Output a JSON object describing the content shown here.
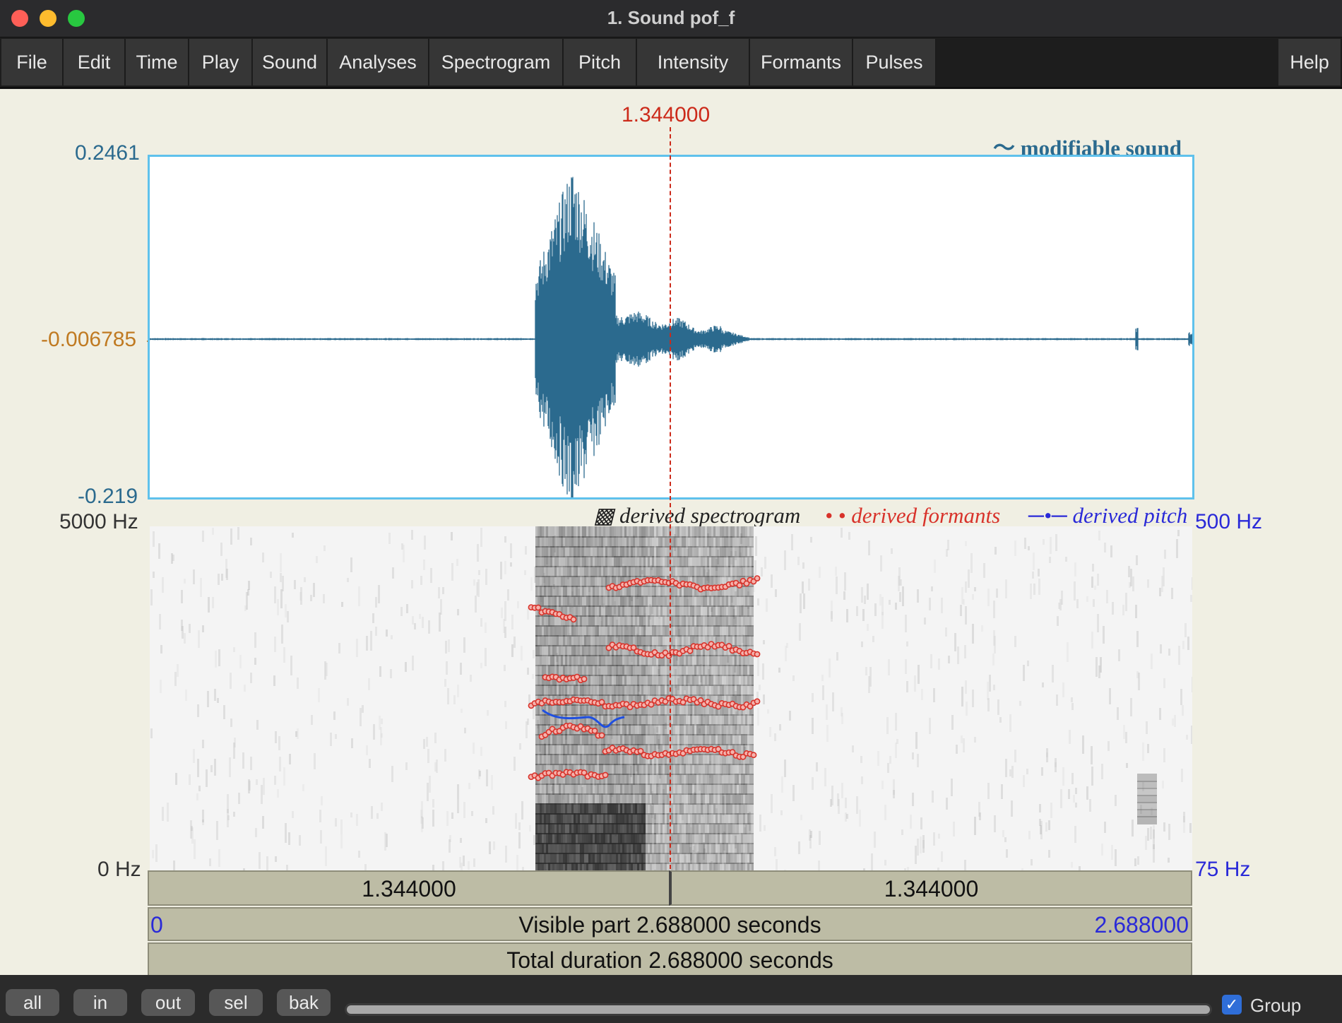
{
  "window": {
    "title": "1. Sound pof_f"
  },
  "menu": {
    "items": [
      {
        "label": "File",
        "name": "menu-file"
      },
      {
        "label": "Edit",
        "name": "menu-edit"
      },
      {
        "label": "Time",
        "name": "menu-time"
      },
      {
        "label": "Play",
        "name": "menu-play"
      },
      {
        "label": "Sound",
        "name": "menu-sound"
      },
      {
        "label": "Analyses",
        "name": "menu-analyses"
      },
      {
        "label": "Spectrogram",
        "name": "menu-spectrogram"
      },
      {
        "label": "Pitch",
        "name": "menu-pitch"
      },
      {
        "label": "Intensity",
        "name": "menu-intensity"
      },
      {
        "label": "Formants",
        "name": "menu-formants"
      },
      {
        "label": "Pulses",
        "name": "menu-pulses"
      }
    ],
    "help": "Help"
  },
  "cursor": {
    "time": "1.344000"
  },
  "waveform": {
    "title_icon": "〜",
    "title": "modifiable sound",
    "y_max": "0.2461",
    "y_mid": "-0.006785",
    "y_min": "-0.219"
  },
  "spectrogram": {
    "freq_max": "5000 Hz",
    "freq_min": "0 Hz",
    "pitch_max": "500 Hz",
    "pitch_min": "75 Hz",
    "legend": {
      "spectrogram_icon": "▩",
      "spectrogram": "derived spectrogram",
      "formants_icon": "• •",
      "formants": "derived formants",
      "pitch_icon": "─•─",
      "pitch": "derived pitch"
    }
  },
  "time_bars": {
    "left_segment": "1.344000",
    "right_segment": "1.344000",
    "visible_start": "0",
    "visible_label": "Visible part 2.688000 seconds",
    "visible_end": "2.688000",
    "total_label": "Total duration 2.688000 seconds"
  },
  "bottom": {
    "buttons": [
      {
        "label": "all",
        "name": "zoom-all-button"
      },
      {
        "label": "in",
        "name": "zoom-in-button"
      },
      {
        "label": "out",
        "name": "zoom-out-button"
      },
      {
        "label": "sel",
        "name": "zoom-sel-button"
      },
      {
        "label": "bak",
        "name": "zoom-back-button"
      }
    ],
    "group_checked": true,
    "group_label": "Group"
  },
  "colors": {
    "waveform": "#2b6a8e",
    "cursor": "#cc2a1a",
    "formant": "#d8322a",
    "pitch": "#1f4fe0",
    "frame": "#5fc1ec"
  }
}
